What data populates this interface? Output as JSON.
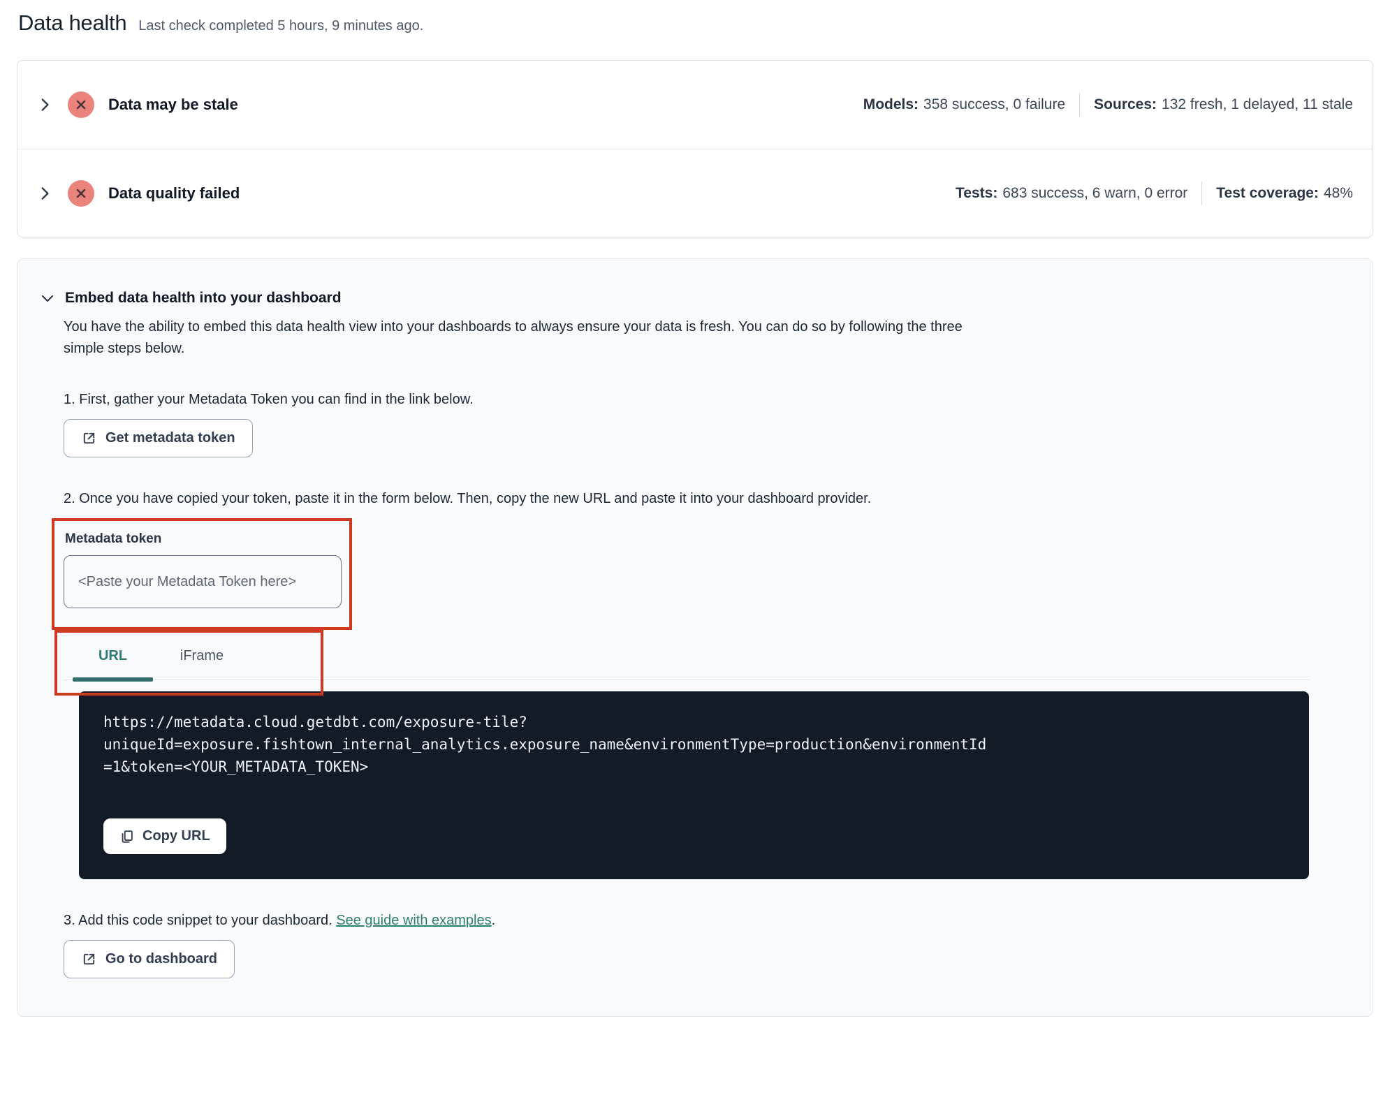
{
  "colors": {
    "highlight": "#CE3A21",
    "teal": "#2F7A74",
    "teal-bar": "#316E6B",
    "link": "#2E7D6E",
    "badge-bg": "#E9837B",
    "badge-x": "#4E333B",
    "code-bg": "#131B27"
  },
  "header": {
    "title": "Data health",
    "subtitle": "Last check completed 5 hours, 9 minutes ago."
  },
  "status": {
    "rows": [
      {
        "title": "Data may be stale",
        "icon": "error-x-icon",
        "stats": [
          {
            "label": "Models:",
            "value": "358 success, 0 failure"
          },
          {
            "label": "Sources:",
            "value": "132 fresh, 1 delayed, 11 stale"
          }
        ]
      },
      {
        "title": "Data quality failed",
        "icon": "error-x-icon",
        "stats": [
          {
            "label": "Tests:",
            "value": "683 success, 6 warn, 0 error"
          },
          {
            "label": "Test coverage:",
            "value": "48%"
          }
        ]
      }
    ]
  },
  "embed": {
    "heading": "Embed data health into your dashboard",
    "description": "You have the ability to embed this data health view into your dashboards to always ensure your data is fresh. You can do so by following the three simple steps below.",
    "step1": {
      "text": "1. First, gather your Metadata Token you can find in the link below.",
      "button_label": "Get metadata token"
    },
    "step2": {
      "text": "2. Once you have copied your token, paste it in the form below. Then, copy the new URL and paste it into your dashboard provider.",
      "field_label": "Metadata token",
      "input_value": "",
      "input_placeholder": "<Paste your Metadata Token here>",
      "tabs": [
        {
          "label": "URL",
          "active": true
        },
        {
          "label": "iFrame",
          "active": false
        }
      ],
      "code_lines": [
        "https://metadata.cloud.getdbt.com/exposure-tile?",
        "uniqueId=exposure.fishtown_internal_analytics.exposure_name&environmentType=production&environmentId",
        "=1&token=<YOUR_METADATA_TOKEN>"
      ],
      "copy_button_label": "Copy URL"
    },
    "step3": {
      "text_before": "3. Add this code snippet to your dashboard. ",
      "link_label": "See guide with examples",
      "text_after": ".",
      "button_label": "Go to dashboard"
    }
  }
}
